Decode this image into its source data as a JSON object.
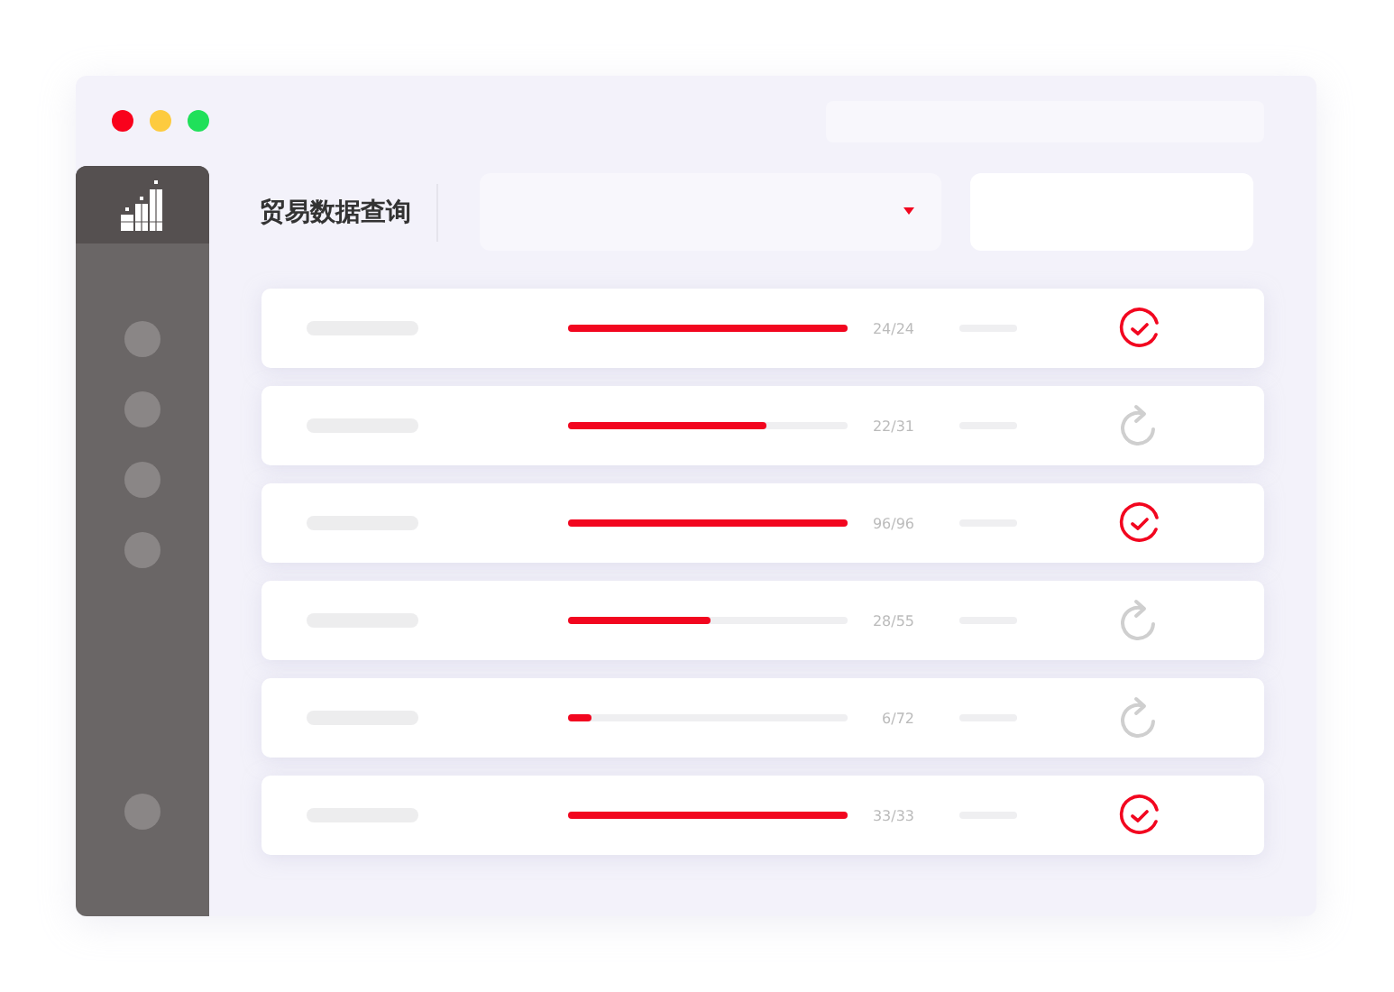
{
  "header": {
    "title": "贸易数据查询"
  },
  "rows": [
    {
      "level": 1,
      "reading": "24/24",
      "kind": "done"
    },
    {
      "level": 0.71,
      "reading": "22/31",
      "kind": "pending"
    },
    {
      "level": 1,
      "reading": "96/96",
      "kind": "done"
    },
    {
      "level": 0.51,
      "reading": "28/55",
      "kind": "pending"
    },
    {
      "level": 0.083,
      "reading": "6/72",
      "kind": "pending"
    },
    {
      "level": 1,
      "reading": "33/33",
      "kind": "done"
    }
  ]
}
